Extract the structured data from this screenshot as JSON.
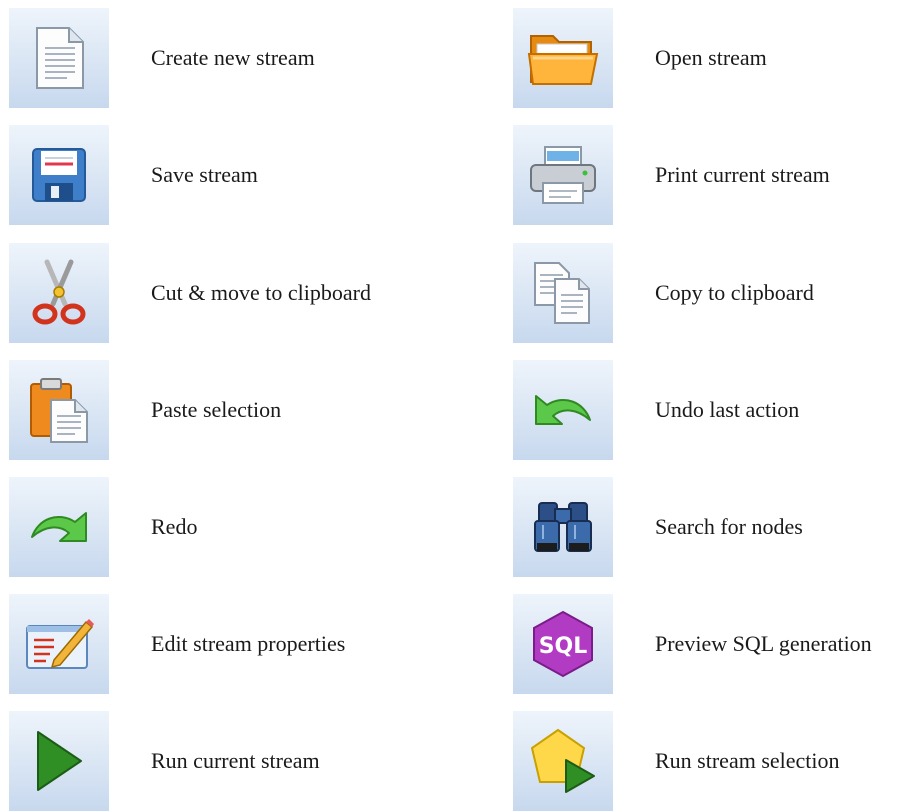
{
  "toolbar": {
    "items": [
      {
        "icon": "new-document-icon",
        "label": "Create new stream"
      },
      {
        "icon": "open-folder-icon",
        "label": "Open stream"
      },
      {
        "icon": "floppy-disk-icon",
        "label": "Save stream"
      },
      {
        "icon": "printer-icon",
        "label": "Print current stream"
      },
      {
        "icon": "scissors-icon",
        "label": "Cut & move to clipboard"
      },
      {
        "icon": "copy-documents-icon",
        "label": "Copy to clipboard"
      },
      {
        "icon": "clipboard-paste-icon",
        "label": "Paste selection"
      },
      {
        "icon": "undo-arrow-icon",
        "label": "Undo last action"
      },
      {
        "icon": "redo-arrow-icon",
        "label": "Redo"
      },
      {
        "icon": "binoculars-icon",
        "label": "Search for nodes"
      },
      {
        "icon": "edit-properties-icon",
        "label": "Edit stream properties"
      },
      {
        "icon": "sql-icon",
        "label": "Preview SQL generation",
        "icon_text": "SQL"
      },
      {
        "icon": "run-play-icon",
        "label": "Run current stream"
      },
      {
        "icon": "run-selection-icon",
        "label": "Run stream selection"
      }
    ]
  }
}
